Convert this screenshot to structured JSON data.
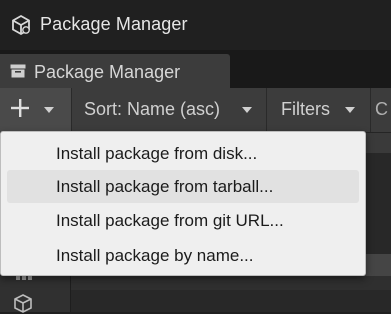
{
  "window": {
    "title": "Package Manager",
    "app_icon": "unity-cube-icon"
  },
  "tab": {
    "label": "Package Manager",
    "icon": "package-tab-icon"
  },
  "toolbar": {
    "add_icon": "plus-icon",
    "sort_label": "Sort: Name (asc)",
    "filters_label": "Filters",
    "clipped_label": "C"
  },
  "menu": {
    "items": [
      {
        "label": "Install package from disk...",
        "hovered": false
      },
      {
        "label": "Install package from tarball...",
        "hovered": true
      },
      {
        "label": "Install package from git URL...",
        "hovered": false
      },
      {
        "label": "Install package by name...",
        "hovered": false
      }
    ]
  },
  "sidebar": {
    "icons": [
      "grid-icon",
      "cube-icon"
    ]
  },
  "colors": {
    "window_bg": "#202020",
    "toolbar_bg": "#3c3c3c",
    "menu_bg": "#efefef",
    "menu_hover": "#e1e1e1",
    "menu_text": "#1b1b1b"
  }
}
